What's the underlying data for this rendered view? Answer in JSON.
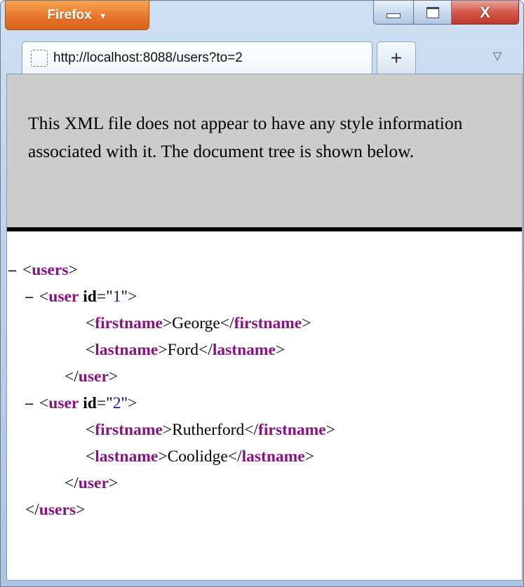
{
  "app": {
    "menu_button_label": "Firefox",
    "menu_caret": "▼"
  },
  "window_controls": {
    "close_label": "X"
  },
  "tab": {
    "url": "http://localhost:8088/users?to=2",
    "new_tab_label": "+",
    "list_all_tabs_icon": "▽"
  },
  "info_message": "This XML file does not appear to have any style information associated with it. The document tree is shown below.",
  "xml_tree": {
    "collapse_symbol": "−",
    "root_tag": "users",
    "users": [
      {
        "tag": "user",
        "attr_name": "id",
        "attr_value": "1",
        "firstname_tag": "firstname",
        "firstname": "George",
        "lastname_tag": "lastname",
        "lastname": "Ford"
      },
      {
        "tag": "user",
        "attr_name": "id",
        "attr_value": "2",
        "firstname_tag": "firstname",
        "firstname": "Rutherford",
        "lastname_tag": "lastname",
        "lastname": "Coolidge"
      }
    ]
  },
  "colors": {
    "tag": "#881280",
    "attribute_value": "#1a1aa6",
    "info_background": "#cccccc",
    "firefox_button": "#e7762a"
  }
}
